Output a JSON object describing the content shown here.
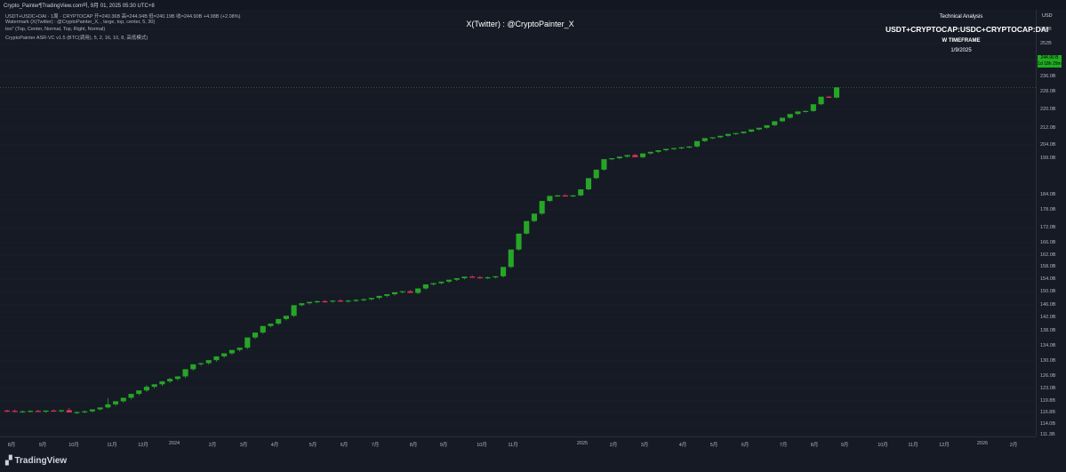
{
  "header": {
    "caption": "Crypto_Painter¶TradingView.com의, 9月 01, 2025 05:30 UTC+8"
  },
  "legend": {
    "line1": "USDT+USDC+DAI · 1周 · CRYPTOCAP  开=240.36B  高=244.94B  低=240.19B  收=244.90B  +4.98B (+2.08%)",
    "line2": "Watermark (X(Twitter) : @CryptoPainter_X, , large, top, center, 5, 30)",
    "line3": "too\" (Top, Center, Normal, Top, Right, Normal)",
    "line4": "CryptoPainter ASR-VC v1.5 (BTC(调用), 5, 2, 16, 10, 8, 高低模式)"
  },
  "watermark": "X(Twitter) : @CryptoPainter_X",
  "technical": {
    "title": "Technical Analysis",
    "symbol": "USDT+CRYPTOCAP:USDC+CRYPTOCAP:DAI",
    "timeframe": "W TIMEFRAME",
    "date": "1/9/2025"
  },
  "axis": {
    "currency": "USD",
    "last_price": "244.90 B",
    "last_countdown": "1d 18h 29m",
    "y_ticks": [
      "260B",
      "252B",
      "244.0B",
      "236.0B",
      "228.0B",
      "220.0B",
      "212.0B",
      "204.0B",
      "199.0B",
      "184.0B",
      "178.0B",
      "172.0B",
      "166.0B",
      "162.0B",
      "158.0B",
      "154.0B",
      "150.0B",
      "146.0B",
      "142.0B",
      "138.0B",
      "134.0B",
      "130.0B",
      "126.0B",
      "123.0B",
      "119.8B",
      "116.8B",
      "114.0B",
      "111.3B"
    ],
    "x_ticks": [
      "8月",
      "9月",
      "10月",
      "11月",
      "12月",
      "2024",
      "2月",
      "3月",
      "4月",
      "5月",
      "6月",
      "7月",
      "8月",
      "9月",
      "10月",
      "11月",
      "2025",
      "2月",
      "3月",
      "4月",
      "5月",
      "6月",
      "7月",
      "8月",
      "9月",
      "10月",
      "11月",
      "12月",
      "2026",
      "2月"
    ]
  },
  "colors": {
    "up": "#26a626",
    "down": "#e0335a",
    "background": "#161a25"
  },
  "logo": {
    "text": "TradingView"
  },
  "chart_data": {
    "type": "candlestick",
    "y_unit": "B USD",
    "y_ticks": [
      260,
      252,
      244,
      236,
      228,
      220,
      212,
      204,
      199,
      184,
      178,
      172,
      166,
      162,
      158,
      154,
      150,
      146,
      142,
      138,
      134,
      130,
      126,
      123,
      119.8,
      116.8,
      114,
      111.3
    ],
    "x_ticks": [
      "8月",
      "9月",
      "10月",
      "11月",
      "12月",
      "2024",
      "2月",
      "3月",
      "4月",
      "5月",
      "6月",
      "7月",
      "8月",
      "9月",
      "10月",
      "11月",
      "2025",
      "2月",
      "3月",
      "4月",
      "5月",
      "6月",
      "7月",
      "8月",
      "9月",
      "10月",
      "11月",
      "12月",
      "2026",
      "2月"
    ],
    "candles": [
      [
        117.3,
        117.5,
        116.9,
        117.2
      ],
      [
        117.2,
        117.6,
        116.9,
        117.0
      ],
      [
        117.0,
        117.3,
        116.7,
        117.1
      ],
      [
        117.1,
        117.4,
        116.8,
        117.2
      ],
      [
        117.2,
        117.5,
        116.9,
        117.0
      ],
      [
        117.0,
        117.3,
        116.7,
        117.3
      ],
      [
        117.3,
        117.6,
        117.0,
        117.1
      ],
      [
        117.1,
        117.4,
        116.8,
        117.4
      ],
      [
        117.4,
        118.0,
        117.0,
        116.8
      ],
      [
        116.8,
        117.1,
        116.4,
        116.9
      ],
      [
        116.9,
        117.3,
        116.6,
        117.1
      ],
      [
        117.1,
        117.5,
        116.8,
        117.6
      ],
      [
        117.6,
        118.0,
        117.3,
        118.1
      ],
      [
        118.1,
        120.5,
        117.8,
        118.9
      ],
      [
        118.9,
        119.3,
        118.5,
        119.7
      ],
      [
        119.7,
        120.1,
        119.3,
        120.6
      ],
      [
        120.6,
        121.0,
        120.2,
        121.6
      ],
      [
        121.6,
        122.0,
        121.2,
        122.5
      ],
      [
        122.5,
        123.8,
        122.1,
        123.4
      ],
      [
        123.4,
        123.8,
        123.0,
        124.0
      ],
      [
        124.0,
        124.8,
        123.6,
        124.7
      ],
      [
        124.7,
        125.6,
        124.3,
        125.3
      ],
      [
        125.3,
        125.7,
        124.9,
        125.9
      ],
      [
        125.9,
        127.5,
        125.5,
        127.8
      ],
      [
        127.8,
        128.2,
        127.4,
        129.1
      ],
      [
        129.1,
        129.5,
        128.7,
        129.4
      ],
      [
        129.4,
        129.8,
        129.0,
        130.2
      ],
      [
        130.2,
        130.6,
        129.8,
        131.2
      ],
      [
        131.2,
        131.6,
        130.8,
        132.0
      ],
      [
        132.0,
        132.4,
        131.6,
        132.9
      ],
      [
        132.9,
        133.3,
        132.5,
        133.5
      ],
      [
        133.5,
        133.9,
        133.1,
        136.2
      ],
      [
        136.2,
        136.6,
        135.8,
        137.5
      ],
      [
        137.5,
        137.9,
        137.1,
        139.4
      ],
      [
        139.4,
        139.8,
        139.0,
        140.1
      ],
      [
        140.1,
        140.5,
        139.7,
        141.5
      ],
      [
        141.5,
        141.9,
        141.1,
        142.5
      ],
      [
        142.5,
        142.9,
        142.1,
        145.9
      ],
      [
        145.9,
        146.3,
        145.5,
        146.5
      ],
      [
        146.5,
        146.9,
        146.1,
        146.9
      ],
      [
        146.9,
        147.3,
        146.5,
        147.1
      ],
      [
        147.1,
        147.5,
        146.7,
        147.0
      ],
      [
        147.0,
        147.4,
        146.6,
        147.3
      ],
      [
        147.3,
        147.7,
        146.9,
        147.1
      ],
      [
        147.1,
        147.5,
        146.7,
        147.3
      ],
      [
        147.3,
        147.7,
        146.9,
        147.5
      ],
      [
        147.5,
        147.9,
        147.1,
        147.7
      ],
      [
        147.7,
        148.1,
        147.3,
        148.1
      ],
      [
        148.1,
        148.5,
        147.7,
        148.7
      ],
      [
        148.7,
        149.1,
        148.3,
        149.2
      ],
      [
        149.2,
        149.6,
        148.8,
        149.8
      ],
      [
        149.8,
        150.2,
        149.4,
        150.1
      ],
      [
        150.1,
        150.5,
        149.7,
        149.6
      ],
      [
        149.6,
        150.0,
        149.2,
        151.0
      ],
      [
        151.0,
        151.4,
        150.6,
        152.3
      ],
      [
        152.3,
        152.7,
        151.9,
        152.7
      ],
      [
        152.7,
        153.1,
        152.3,
        153.2
      ],
      [
        153.2,
        153.6,
        152.8,
        153.8
      ],
      [
        153.8,
        154.2,
        153.4,
        154.3
      ],
      [
        154.3,
        154.7,
        153.9,
        154.8
      ],
      [
        154.8,
        155.2,
        154.4,
        154.6
      ],
      [
        154.6,
        155.0,
        154.2,
        154.4
      ],
      [
        154.4,
        154.8,
        154.0,
        154.6
      ],
      [
        154.6,
        155.0,
        154.2,
        154.9
      ],
      [
        154.9,
        155.3,
        154.5,
        157.9
      ],
      [
        157.9,
        158.3,
        157.5,
        163.8
      ],
      [
        163.8,
        164.2,
        163.4,
        169.6
      ],
      [
        169.6,
        170.0,
        169.2,
        174.2
      ],
      [
        174.2,
        174.6,
        173.8,
        176.7
      ],
      [
        176.7,
        177.1,
        176.3,
        181.5
      ],
      [
        181.5,
        181.9,
        181.1,
        183.5
      ],
      [
        183.5,
        183.9,
        183.1,
        183.7
      ],
      [
        183.7,
        184.1,
        183.3,
        183.5
      ],
      [
        183.5,
        183.9,
        183.1,
        183.7
      ],
      [
        183.7,
        184.1,
        183.3,
        186.2
      ],
      [
        186.2,
        186.6,
        185.8,
        190.8
      ],
      [
        190.8,
        191.2,
        190.4,
        194.3
      ],
      [
        194.3,
        194.7,
        193.9,
        198.6
      ],
      [
        198.6,
        199.0,
        198.2,
        199.0
      ],
      [
        199.0,
        199.4,
        198.6,
        199.6
      ],
      [
        199.6,
        200.0,
        199.2,
        200.2
      ],
      [
        200.2,
        200.6,
        199.8,
        199.4
      ],
      [
        199.4,
        199.8,
        199.0,
        200.8
      ],
      [
        200.8,
        201.2,
        200.4,
        201.4
      ],
      [
        201.4,
        201.8,
        201.0,
        202.0
      ],
      [
        202.0,
        202.4,
        201.6,
        202.5
      ],
      [
        202.5,
        202.9,
        202.1,
        202.8
      ],
      [
        202.8,
        203.2,
        202.4,
        203.1
      ],
      [
        203.1,
        203.5,
        202.7,
        203.4
      ],
      [
        203.4,
        203.8,
        203.0,
        205.8
      ],
      [
        205.8,
        206.2,
        205.4,
        207.2
      ],
      [
        207.2,
        207.6,
        206.8,
        207.6
      ],
      [
        207.6,
        208.0,
        207.2,
        208.3
      ],
      [
        208.3,
        208.7,
        207.9,
        209.2
      ],
      [
        209.2,
        209.6,
        208.8,
        209.6
      ],
      [
        209.6,
        210.0,
        209.2,
        210.3
      ],
      [
        210.3,
        210.7,
        209.9,
        211.3
      ],
      [
        211.3,
        211.7,
        210.9,
        212.1
      ],
      [
        212.1,
        212.5,
        211.7,
        213.2
      ],
      [
        213.2,
        213.6,
        212.8,
        214.9
      ],
      [
        214.9,
        215.3,
        214.5,
        216.4
      ],
      [
        216.4,
        216.8,
        216.0,
        218.0
      ],
      [
        218.0,
        218.4,
        217.6,
        219.1
      ],
      [
        219.1,
        219.5,
        218.7,
        219.3
      ],
      [
        219.3,
        219.7,
        218.9,
        222.3
      ],
      [
        222.3,
        222.7,
        221.9,
        225.7
      ],
      [
        225.7,
        226.1,
        225.3,
        225.3
      ],
      [
        225.3,
        225.7,
        224.9,
        230.2
      ]
    ]
  }
}
